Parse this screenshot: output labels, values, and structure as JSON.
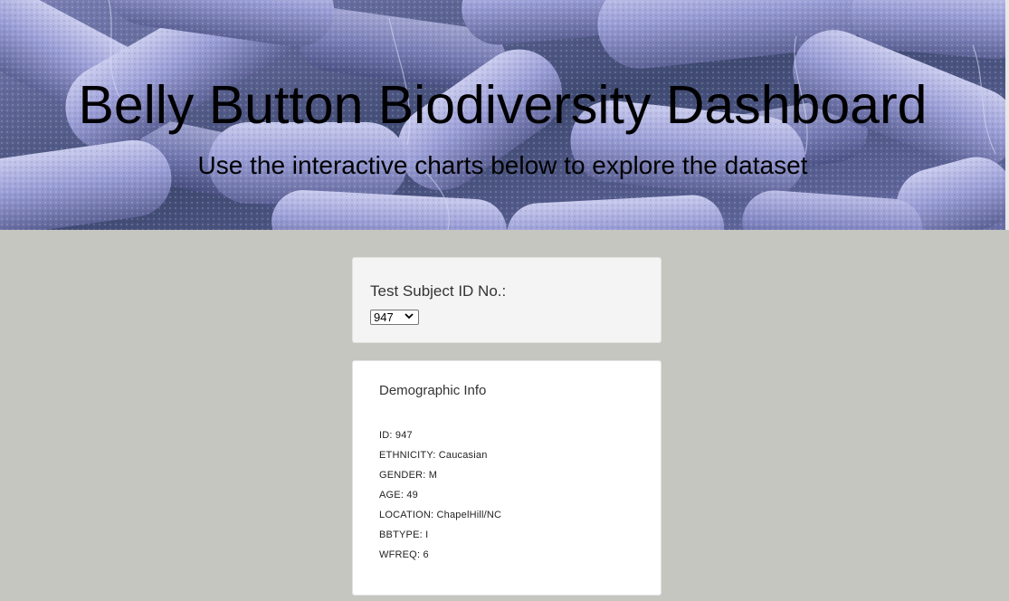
{
  "hero": {
    "title": "Belly Button Biodiversity Dashboard",
    "subtitle": "Use the interactive charts below to explore the dataset"
  },
  "selector": {
    "label": "Test Subject ID No.:",
    "selected_value": "947"
  },
  "demographics": {
    "heading": "Demographic Info",
    "rows": [
      "ID: 947",
      "ETHNICITY: Caucasian",
      "GENDER: M",
      "AGE: 49",
      "LOCATION: ChapelHill/NC",
      "BBTYPE: I",
      "WFREQ: 6"
    ]
  },
  "colors": {
    "page_background": "#c5c6c0",
    "hero_tint": "#8e8fc8",
    "panel_gray": "#f4f4f4",
    "panel_white": "#ffffff"
  }
}
